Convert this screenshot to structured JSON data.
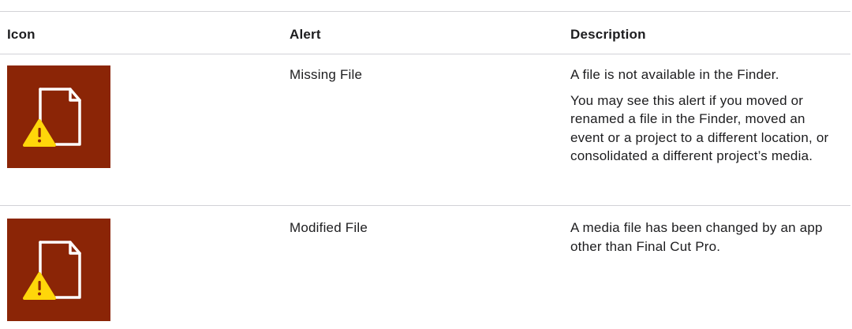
{
  "table": {
    "headers": {
      "icon": "Icon",
      "alert": "Alert",
      "description": "Description"
    },
    "rows": [
      {
        "icon": "missing-file-alert-icon",
        "alert": "Missing File",
        "description": [
          "A file is not available in the Finder.",
          "You may see this alert if you moved or renamed a file in the Finder, moved an event or a project to a different location, or consolidated a different project’s media."
        ]
      },
      {
        "icon": "modified-file-alert-icon",
        "alert": "Modified File",
        "description": [
          "A media file has been changed by an app other than Final Cut Pro."
        ]
      }
    ]
  },
  "colors": {
    "icon_background": "#8b2506",
    "warning_triangle": "#ffd60a",
    "divider": "#d2d2d7"
  }
}
